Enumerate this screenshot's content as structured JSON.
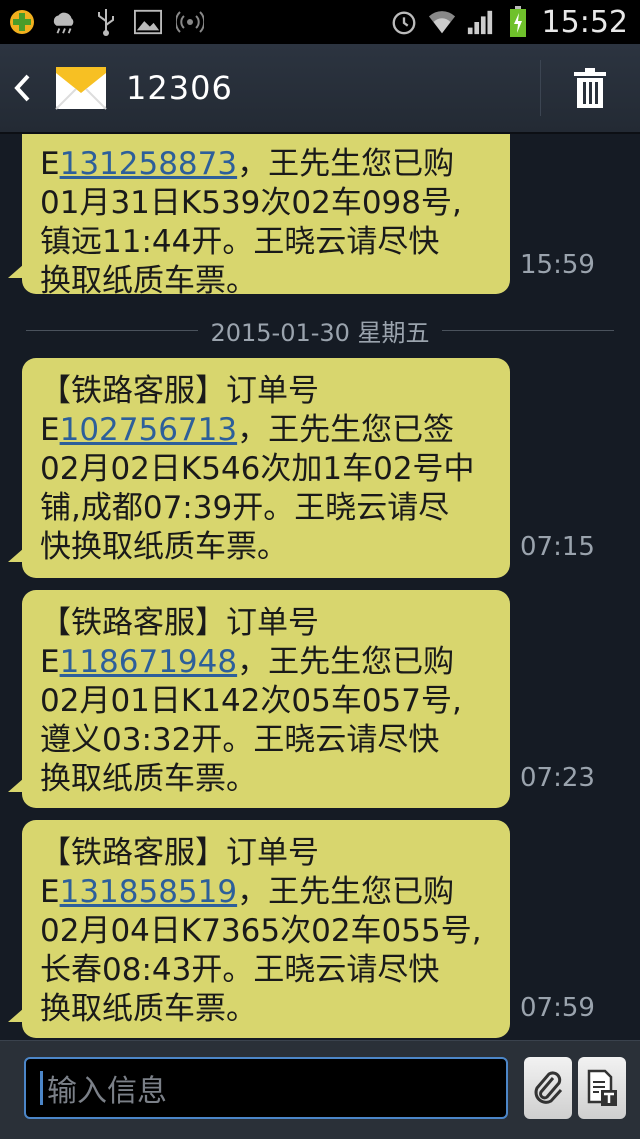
{
  "status": {
    "time": "15:52"
  },
  "header": {
    "title": "12306"
  },
  "messages": [
    {
      "prefix_line": "",
      "order_prefix": "E",
      "order_number": "131258873",
      "order_suffix": "，王先生您已购",
      "line3": "01月31日K539次02车098号,",
      "line4": "镇远11:44开。王晓云请尽快",
      "line5": "换取纸质车票。",
      "time": "15:59"
    },
    {
      "prefix_line": "【铁路客服】订单号",
      "order_prefix": "E",
      "order_number": "102756713",
      "order_suffix": "，王先生您已签",
      "line3": "02月02日K546次加1车02号中",
      "line4": "铺,成都07:39开。王晓云请尽",
      "line5": "快换取纸质车票。",
      "time": "07:15"
    },
    {
      "prefix_line": "【铁路客服】订单号",
      "order_prefix": "E",
      "order_number": "118671948",
      "order_suffix": "，王先生您已购",
      "line3": "02月01日K142次05车057号,",
      "line4": "遵义03:32开。王晓云请尽快",
      "line5": "换取纸质车票。",
      "time": "07:23"
    },
    {
      "prefix_line": "【铁路客服】订单号",
      "order_prefix": "E",
      "order_number": "131858519",
      "order_suffix": "，王先生您已购",
      "line3": "02月04日K7365次02车055号,",
      "line4": "长春08:43开。王晓云请尽快",
      "line5": "换取纸质车票。",
      "time": "07:59"
    }
  ],
  "date_separator": "2015-01-30 星期五",
  "composer": {
    "placeholder": "输入信息"
  },
  "colors": {
    "bubble": "#d8d66e",
    "link": "#2d5f9a",
    "background": "#151b24"
  }
}
